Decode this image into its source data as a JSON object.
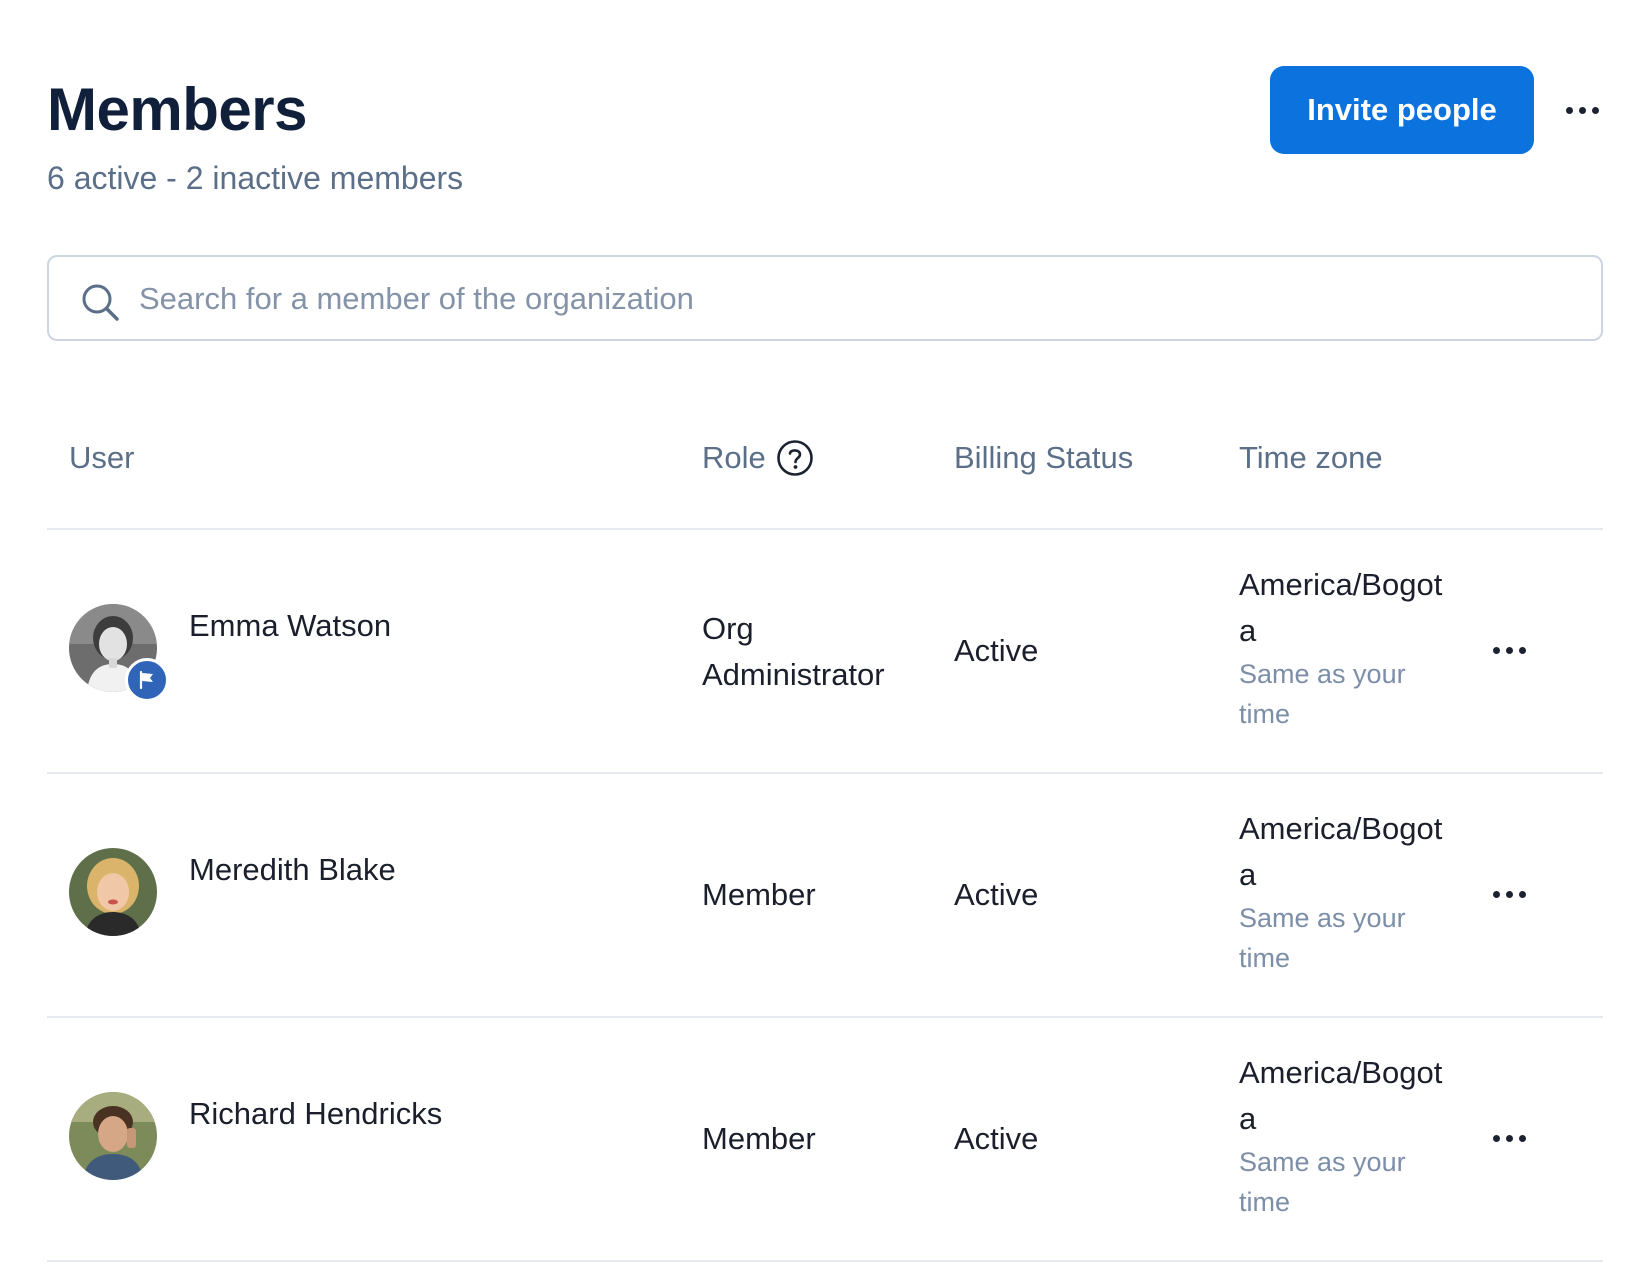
{
  "header": {
    "title": "Members",
    "subtitle": "6 active - 2 inactive members",
    "invite_label": "Invite people",
    "more_icon": "more-horizontal-icon"
  },
  "search": {
    "placeholder": "Search for a member of the organization",
    "value": "",
    "icon": "search-icon"
  },
  "table": {
    "headers": {
      "user": "User",
      "role": "Role",
      "billing": "Billing Status",
      "timezone": "Time zone"
    },
    "role_help_icon": "question-circle-icon",
    "rows": [
      {
        "name": "Emma Watson",
        "role": "Org Administrator",
        "billing": "Active",
        "timezone": "America/Bogota",
        "timezone_note": "Same as your time",
        "badge_icon": "flag-icon"
      },
      {
        "name": "Meredith Blake",
        "role": "Member",
        "billing": "Active",
        "timezone": "America/Bogota",
        "timezone_note": "Same as your time"
      },
      {
        "name": "Richard Hendricks",
        "role": "Member",
        "billing": "Active",
        "timezone": "America/Bogota",
        "timezone_note": "Same as your time"
      }
    ]
  },
  "colors": {
    "accent": "#0b72de",
    "title": "#10203b",
    "muted": "#5b6f89",
    "badge": "#2f64b8",
    "divider": "#e6eaf0"
  }
}
